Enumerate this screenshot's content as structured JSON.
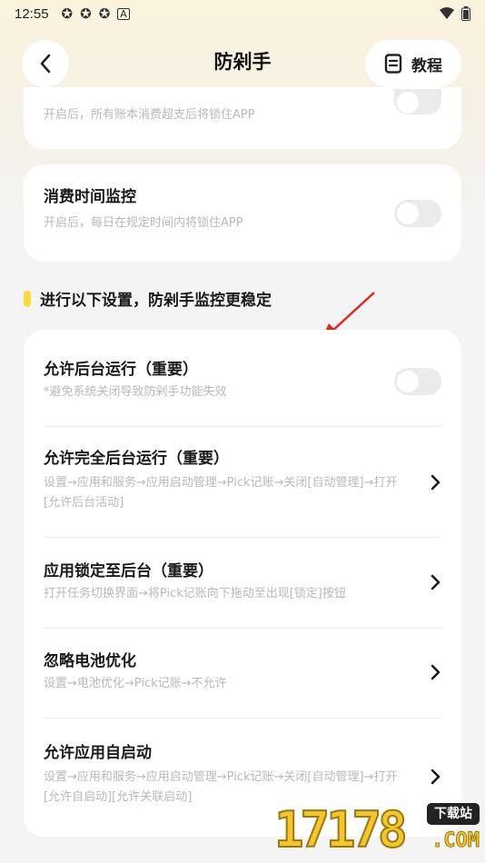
{
  "status_bar": {
    "time": "12:55",
    "icons": [
      "app-icon",
      "app-icon",
      "app-icon",
      "notification-icon"
    ],
    "right_icons": [
      "wifi-icon",
      "battery-icon"
    ]
  },
  "header": {
    "title": "防剁手",
    "tutorial_label": "教程"
  },
  "top_card": {
    "desc": "开启后，所有账本消费超支后将锁住APP",
    "enabled": false
  },
  "time_monitor": {
    "title": "消费时间监控",
    "desc": "开启后，每日在规定时间内将锁住APP",
    "enabled": false
  },
  "section": {
    "heading": "进行以下设置，防剁手监控更稳定",
    "accent_color": "#ffd83a"
  },
  "settings": [
    {
      "title": "允许后台运行（重要）",
      "desc": "*避免系统关闭导致防剁手功能失效",
      "control": "toggle",
      "enabled": false
    },
    {
      "title": "允许完全后台运行（重要）",
      "desc": "设置→应用和服务→应用启动管理→Pick记账→关闭[自动管理]→打开[允许后台活动]",
      "control": "chevron"
    },
    {
      "title": "应用锁定至后台（重要）",
      "desc": "打开任务切换界面→将Pick记账向下拖动至出现[锁定]按钮",
      "control": "chevron"
    },
    {
      "title": "忽略电池优化",
      "desc": "设置→电池优化→Pick记账→不允许",
      "control": "chevron"
    },
    {
      "title": "允许应用自启动",
      "desc": "设置→应用和服务→应用启动管理→Pick记账→关闭[自动管理]→打开[允许自启动][允许关联启动]",
      "control": "chevron"
    }
  ],
  "watermark": {
    "number": "17178",
    "badge": "下载站",
    "domain": ".COM"
  }
}
